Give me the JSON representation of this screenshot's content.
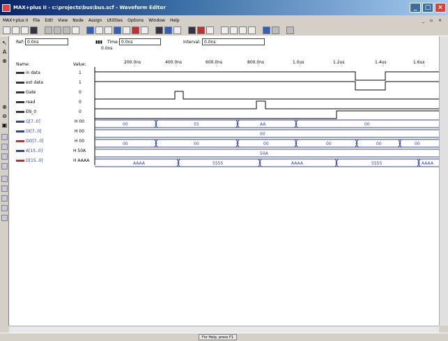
{
  "window": {
    "title": "MAX+plus II - c:\\projects\\bus\\bus.scf - Waveform Editor"
  },
  "menu": {
    "items": [
      "MAX+plus II",
      "File",
      "Edit",
      "View",
      "Node",
      "Assign",
      "Utilities",
      "Options",
      "Window",
      "Help"
    ]
  },
  "header": {
    "ref_label": "Ref:",
    "ref_value": "0.0ns",
    "time_label": "Time:",
    "time_value": "0.0ns",
    "interval_label": "Interval:",
    "interval_value": "0.0ns",
    "zero_label": "0.0ns",
    "name_col": "Name:",
    "value_col": "Value:"
  },
  "time_ticks": [
    "200.0ns",
    "400.0ns",
    "600.0ns",
    "800.0ns",
    "1.0us",
    "1.2us",
    "1.4us",
    "1.6us"
  ],
  "signals": [
    {
      "name": "in data",
      "value": "1",
      "bus": false
    },
    {
      "name": "ext data",
      "value": "1",
      "bus": false
    },
    {
      "name": "Gate",
      "value": "0",
      "bus": false
    },
    {
      "name": "read",
      "value": "0",
      "bus": false
    },
    {
      "name": "EN_0",
      "value": "0",
      "bus": false
    },
    {
      "name": "Q[7..0]",
      "value": "H 00",
      "bus": true
    },
    {
      "name": "DI[7..0]",
      "value": "H 00",
      "bus": true
    },
    {
      "name": "DO[7..0]",
      "value": "H 00",
      "bus": true
    },
    {
      "name": "A[15..0]",
      "value": "H 50A",
      "bus": true
    },
    {
      "name": "D[15..0]",
      "value": "H AAAA",
      "bus": true
    }
  ],
  "bus_segments": {
    "q": [
      "00",
      "55",
      "AA",
      "00"
    ],
    "di": [
      "00"
    ],
    "do": [
      "00",
      "00",
      "00",
      "00",
      "00",
      "00"
    ],
    "a": [
      "50A"
    ],
    "d": [
      "AAAA",
      "5555",
      "AAAA",
      "5555",
      "AAAA"
    ]
  },
  "status": {
    "text": "For Help, press F1"
  }
}
